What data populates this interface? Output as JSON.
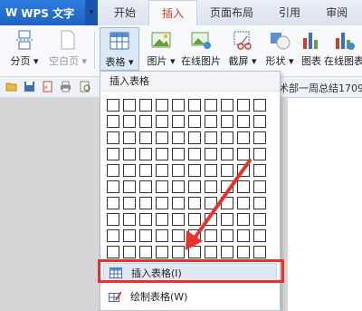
{
  "app": {
    "logo": "W",
    "title": "WPS 文字",
    "caret": "▾"
  },
  "tabs": [
    {
      "label": "开始"
    },
    {
      "label": "插入"
    },
    {
      "label": "页面布局"
    },
    {
      "label": "引用"
    },
    {
      "label": "审阅"
    }
  ],
  "active_tab": "插入",
  "ribbon": {
    "fenye": "分页",
    "kongbaiye": "空白页",
    "biaoge": "表格",
    "tupian": "图片",
    "zaixian_tupian": "在线图片",
    "jieping": "截屏",
    "xingzhuang": "形状",
    "tubiao": "图表",
    "zaixian_tubiao": "在线图表"
  },
  "document": {
    "tab_text": "术部一周总结1709"
  },
  "table_menu": {
    "title": "插入表格",
    "grid": {
      "rows": 10,
      "cols": 10
    },
    "items": [
      {
        "label": "插入表格(I)",
        "icon": "table-insert-icon"
      },
      {
        "label": "绘制表格(W)",
        "icon": "table-draw-icon"
      }
    ]
  },
  "colors": {
    "accent": "#2e7de0",
    "highlight": "#e8312a"
  }
}
